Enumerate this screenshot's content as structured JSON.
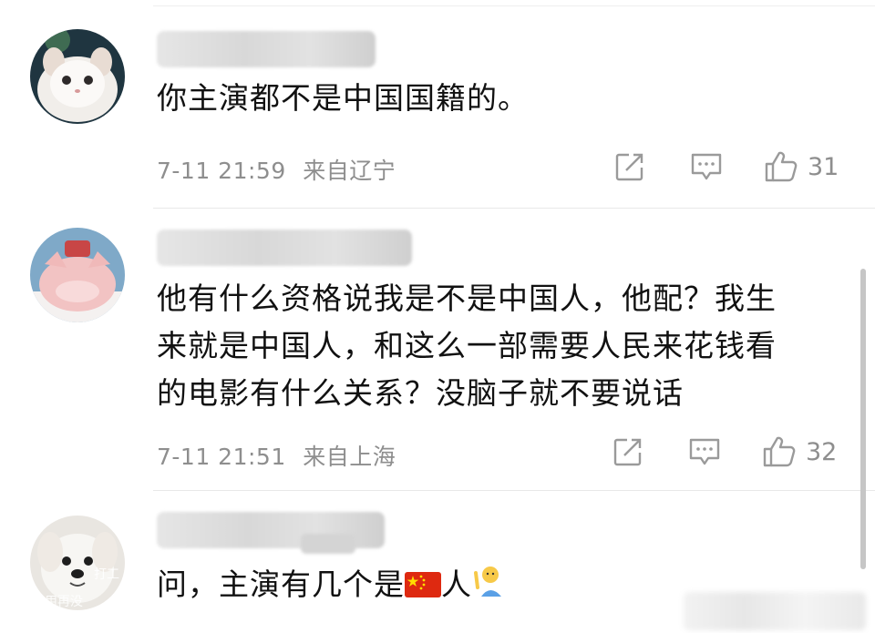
{
  "comments": [
    {
      "text": "你主演都不是中国国籍的。",
      "time": "7-11 21:59",
      "location": "来自辽宁",
      "likes": "31"
    },
    {
      "lines": [
        "他有什么资格说我是不是中国人，他配？我生",
        "来就是中国人，和这么一部需要人民来花钱看",
        "的电影有什么关系？没脑子就不要说话"
      ],
      "time": "7-11 21:51",
      "location": "来自上海",
      "likes": "32"
    },
    {
      "text_before": "问，主演有几个是",
      "text_after": "人",
      "avatar_caption": "打工",
      "avatar_caption2": "用再没"
    }
  ],
  "icons": {
    "repost": "share-icon",
    "reply": "comment-icon",
    "like": "thumbs-up-icon",
    "flag": "china-flag-icon",
    "emoji": "waving-person-icon"
  },
  "colors": {
    "meta": "#8e8e8e",
    "text": "#111111",
    "flag_red": "#de2910",
    "flag_yellow": "#ffde00"
  }
}
